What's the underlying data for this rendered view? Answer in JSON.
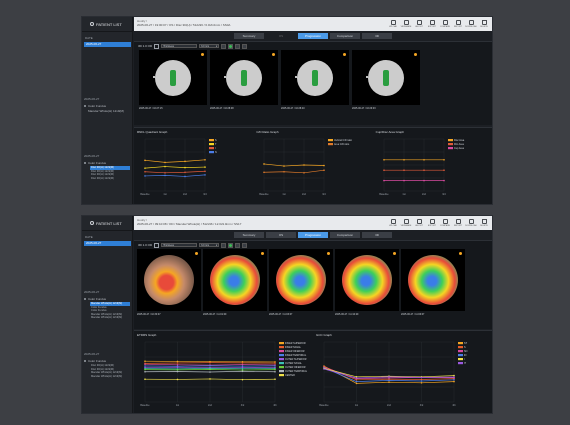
{
  "w1": {
    "sidebar": {
      "title": "PATIENT LIST",
      "date_label": "DATE",
      "date_selected": "2025-06-27",
      "groups": [
        {
          "date": "2025-06-27",
          "categories": [
            {
              "label": "Color Fundus",
              "scans": []
            },
            {
              "label": "Macular Whole(H) 12x9(M)",
              "scans": []
            }
          ]
        },
        {
          "date": "2025-06-27",
          "categories": [
            {
              "label": "Color Fundus",
              "scans": [
                {
                  "label": "Disc 3D(H) 12x9(M)",
                  "selected": true
                },
                {
                  "label": "Disc 3D(H) 12x9(M)",
                  "selected": false
                },
                {
                  "label": "Disc 3D(H) 12x9(M)",
                  "selected": false
                },
                {
                  "label": "Disc 3D(H) 12x9(M)",
                  "selected": false
                }
              ]
            }
          ]
        }
      ]
    },
    "breadcrumb": {
      "line1": "Hoolly /",
      "line2": "2025-06-27 / 19:00:07 / OS / Disc 3D(H) / 512x96 / 6.0x6.0mm / SS0A"
    },
    "toolbar": [
      "UPLOAD",
      "VIEWHARE",
      "LAYOUT",
      "EXPORT",
      "COMPARE",
      "REPORT",
      "DOWNLOAD",
      "DELETE"
    ],
    "tabs": [
      {
        "label": "Summary",
        "active": false
      },
      {
        "label": "OS",
        "active": false
      },
      {
        "label": "Progression",
        "active": true
      },
      {
        "label": "Comparison",
        "active": false
      },
      {
        "label": "3D",
        "active": false
      }
    ],
    "panel": {
      "label": "3D 1.0 OD",
      "select_label": "Thickness",
      "select_value": "6.0 mm"
    },
    "thumbs": [
      {
        "caption": "2025-06-27 / 16:27:15"
      },
      {
        "caption": "2025-06-27 / 16:28:08"
      },
      {
        "caption": "2025-06-27 / 16:28:40"
      },
      {
        "caption": "2025-06-27 / 16:29:03"
      }
    ],
    "charts": [
      {
        "title": "RNFL Quadrant Graph",
        "x": [
          "Baseline",
          "1st",
          "2nd",
          "3rd"
        ],
        "ylim": [
          0,
          200
        ],
        "series": [
          {
            "name": "S",
            "color": "#f5a623",
            "values": [
              118,
              110,
              114,
              120
            ]
          },
          {
            "name": "T",
            "color": "#f5d623",
            "values": [
              88,
              94,
              90,
              92
            ]
          },
          {
            "name": "I",
            "color": "#e05a3a",
            "values": [
              74,
              70,
              72,
              76
            ]
          },
          {
            "name": "N",
            "color": "#4b7de8",
            "values": [
              58,
              60,
              56,
              62
            ]
          }
        ]
      },
      {
        "title": "C/D Ratio Graph",
        "x": [
          "Baseline",
          "1st",
          "2nd",
          "3rd"
        ],
        "ylim": [
          0,
          1
        ],
        "series": [
          {
            "name": "Vertical C/D ratio",
            "color": "#f5a623",
            "values": [
              0.52,
              0.48,
              0.5,
              0.49
            ]
          },
          {
            "name": "Area C/D ratio",
            "color": "#e07a2a",
            "values": [
              0.36,
              0.37,
              0.35,
              0.4
            ]
          }
        ]
      },
      {
        "title": "Cup/Disc Area Graph",
        "x": [
          "Baseline",
          "1st",
          "2nd",
          "3rd"
        ],
        "ylim": [
          0,
          3
        ],
        "series": [
          {
            "name": "Disc Area",
            "color": "#f5a623",
            "values": [
              1.8,
              1.8,
              1.8,
              1.8
            ]
          },
          {
            "name": "Rim Area",
            "color": "#e05a3a",
            "values": [
              1.2,
              1.2,
              1.2,
              1.2
            ]
          },
          {
            "name": "Cup Area",
            "color": "#d94aa0",
            "values": [
              0.6,
              0.6,
              0.6,
              0.6
            ]
          }
        ]
      }
    ]
  },
  "w2": {
    "sidebar": {
      "title": "PATIENT LIST",
      "date_label": "DATE",
      "date_selected": "2025-06-27",
      "groups": [
        {
          "date": "2025-06-27",
          "categories": [
            {
              "label": "Color Fundus",
              "scans": [
                {
                  "label": "Macular Whole(H) 12x9(M)",
                  "selected": true
                },
                {
                  "label": "Color Fundus",
                  "selected": false
                },
                {
                  "label": "Color Fundus",
                  "selected": false
                },
                {
                  "label": "Macular Whole(H) 12x9(M)",
                  "selected": false
                },
                {
                  "label": "Macular Whole(H) 12x9(M)",
                  "selected": false
                }
              ]
            }
          ]
        },
        {
          "date": "2025-06-27",
          "categories": [
            {
              "label": "Color Fundus",
              "scans": [
                {
                  "label": "Disc 3D(H) 12x9(M)",
                  "selected": false
                },
                {
                  "label": "Disc 3D(H) 12x9(M)",
                  "selected": false
                },
                {
                  "label": "Macular Whole(H) 12x9(M)",
                  "selected": false
                },
                {
                  "label": "Macular Whole(H) 12x9(M)",
                  "selected": false
                }
              ]
            }
          ]
        }
      ]
    },
    "breadcrumb": {
      "line1": "Hoolly /",
      "line2": "2025-06-27 / 09:10:08 / OD / Macular Whole(H) / 512x96 / 12.0x9.0mm / SS17"
    },
    "toolbar": [
      "UPLOAD",
      "VIEWHARE",
      "LAYOUT",
      "EXPORT",
      "COMPARE",
      "REPORT",
      "DOWNLOAD",
      "DELETE"
    ],
    "tabs": [
      {
        "label": "Summary",
        "active": false
      },
      {
        "label": "OS",
        "active": false
      },
      {
        "label": "Progression",
        "active": true
      },
      {
        "label": "Comparison",
        "active": false
      },
      {
        "label": "3D",
        "active": false
      }
    ],
    "panel": {
      "label": "3D 1.0 OD",
      "select_label": "Thickness",
      "select_value": "6.0 mm"
    },
    "thumbs": [
      {
        "caption": "2025-06-27 / 10:30:07"
      },
      {
        "caption": "2025-06-27 / 11:01:09"
      },
      {
        "caption": "2025-06-27 / 11:03:07"
      },
      {
        "caption": "2025-06-27 / 11:10:29"
      },
      {
        "caption": "2025-06-27 / 11:06:07"
      }
    ],
    "charts": [
      {
        "title": "ETDRS Graph",
        "x": [
          "Baseline",
          "1st",
          "2nd",
          "3rd",
          "4th"
        ],
        "ylim": [
          0,
          500
        ],
        "series": [
          {
            "name": "INNER SUPERIOR",
            "color": "#f5a623",
            "values": [
              340,
              338,
              336,
              335,
              334
            ]
          },
          {
            "name": "INNER NASAL",
            "color": "#e85d2a",
            "values": [
              322,
              325,
              328,
              326,
              324
            ]
          },
          {
            "name": "INNER INFERIOR",
            "color": "#d94aa0",
            "values": [
              315,
              310,
              308,
              312,
              309
            ]
          },
          {
            "name": "INNER TEMPORAL",
            "color": "#4b7de8",
            "values": [
              300,
              298,
              302,
              299,
              301
            ]
          },
          {
            "name": "OUTER SUPERIOR",
            "color": "#9b59e0",
            "values": [
              288,
              290,
              286,
              289,
              287
            ]
          },
          {
            "name": "OUTER NASAL",
            "color": "#3cc1b4",
            "values": [
              278,
              276,
              280,
              277,
              279
            ]
          },
          {
            "name": "OUTER INFERIOR",
            "color": "#6dcf3e",
            "values": [
              270,
              268,
              272,
              266,
              270
            ]
          },
          {
            "name": "OUTER TEMPORAL",
            "color": "#b0b6be",
            "values": [
              252,
              254,
              250,
              256,
              252
            ]
          },
          {
            "name": "CENTER",
            "color": "#f0e24a",
            "values": [
              190,
              188,
              192,
              186,
              190
            ]
          }
        ]
      },
      {
        "title": "GCC Graph",
        "x": [
          "Baseline",
          "1st",
          "2nd",
          "3rd",
          "4th"
        ],
        "ylim": [
          0,
          200
        ],
        "series": [
          {
            "name": "ST",
            "color": "#f5a623",
            "values": [
              120,
              62,
              66,
              64,
              68
            ]
          },
          {
            "name": "S",
            "color": "#e85d2a",
            "values": [
              118,
              74,
              76,
              75,
              78
            ]
          },
          {
            "name": "SN",
            "color": "#d94aa0",
            "values": [
              116,
              78,
              80,
              82,
              81
            ]
          },
          {
            "name": "IN",
            "color": "#4b7de8",
            "values": [
              114,
              68,
              72,
              70,
              74
            ]
          },
          {
            "name": "I",
            "color": "#f0e24a",
            "values": [
              112,
              84,
              86,
              84,
              88
            ]
          },
          {
            "name": "IT",
            "color": "#9b59e0",
            "values": [
              110,
              80,
              84,
              82,
              83
            ]
          }
        ]
      }
    ]
  }
}
